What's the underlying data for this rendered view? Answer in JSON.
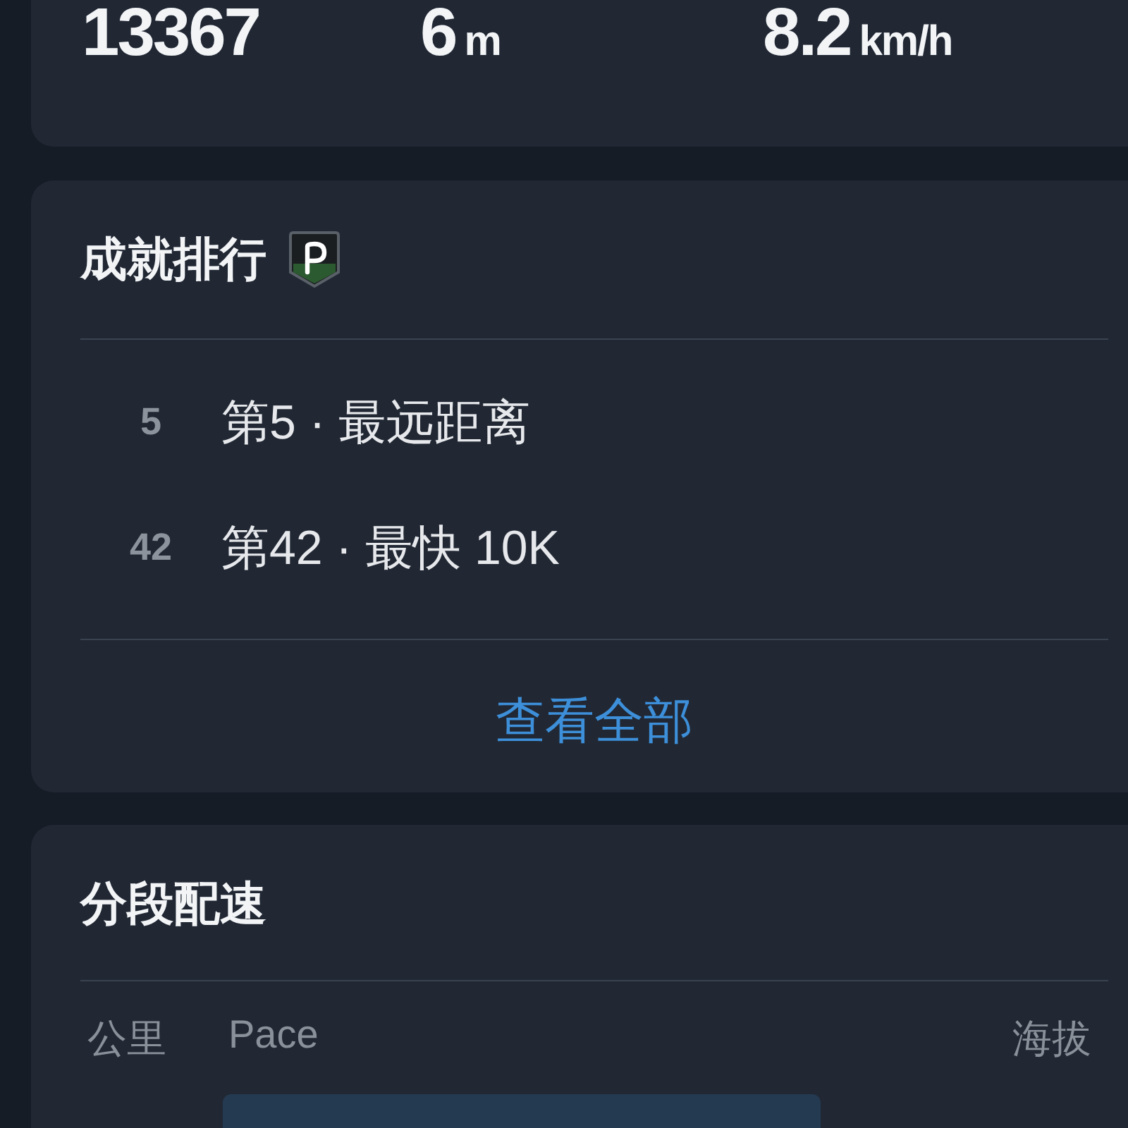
{
  "stats": [
    {
      "value": "13367"
    },
    {
      "value": "6",
      "unit": "m"
    },
    {
      "value": "8.2",
      "unit": "km/h"
    }
  ],
  "achievements": {
    "title": "成就排行",
    "rows": [
      {
        "rank": "5",
        "label": "第5 · 最远距离"
      },
      {
        "rank": "42",
        "label": "第42 · 最快 10K"
      }
    ],
    "link": "查看全部"
  },
  "splits": {
    "title": "分段配速",
    "columns": [
      "公里",
      "Pace",
      "海拔"
    ]
  }
}
